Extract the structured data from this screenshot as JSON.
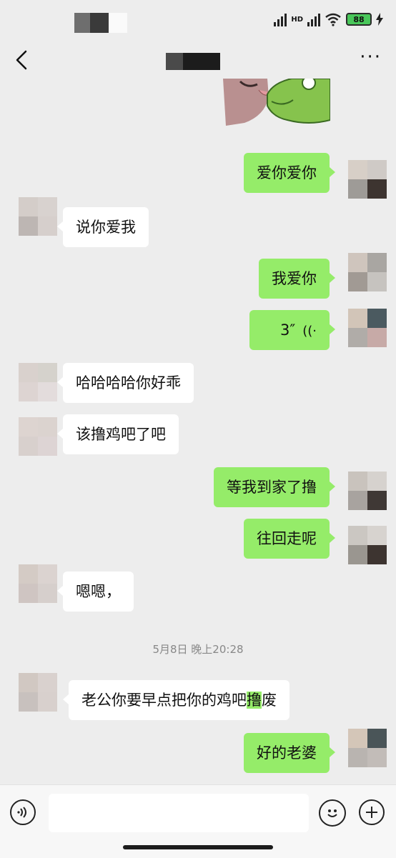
{
  "status_bar": {
    "network": "HD",
    "battery": "88"
  },
  "title_bar": {
    "back_icon": "chevron-left-icon",
    "more_icon": "more-icon",
    "more_label": "···"
  },
  "messages": {
    "m1": "爱你爱你",
    "m2": "说你爱我",
    "m3": "我爱你",
    "m4_voice_duration": "3″",
    "m5": "哈哈哈哈你好乖",
    "m6": "该撸鸡吧了吧",
    "m7": "等我到家了撸",
    "m8": "往回走呢",
    "m9": "嗯嗯，",
    "m10_a": "老公你要早点把你的鸡吧",
    "m10_b": "撸",
    "m10_c": "废",
    "m11": "好的老婆"
  },
  "timestamp": "5月8日 晚上20:28",
  "input_bar": {
    "voice_icon": "voice-icon",
    "emoji_icon": "emoji-icon",
    "plus_icon": "plus-icon"
  },
  "colors": {
    "outgoing_bubble": "#95ec69",
    "incoming_bubble": "#ffffff",
    "background": "#ededed"
  }
}
